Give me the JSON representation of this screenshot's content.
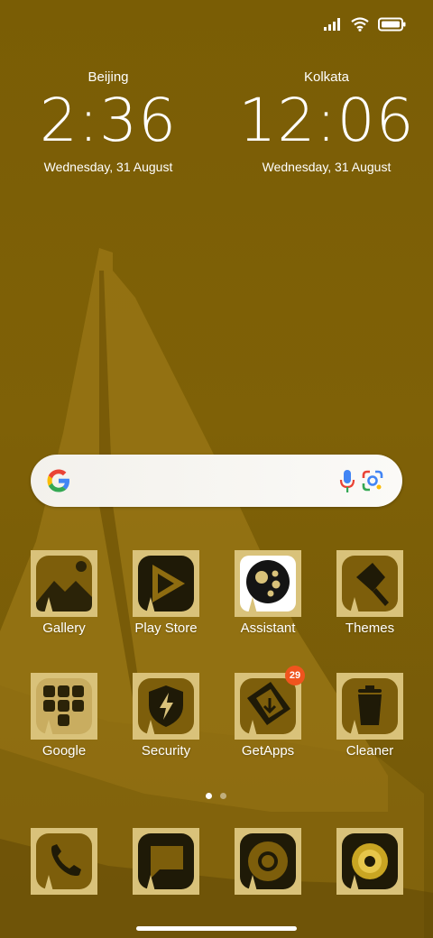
{
  "status": {
    "signal_icon": "signal-bars-icon",
    "wifi_icon": "wifi-icon",
    "battery_icon": "battery-icon",
    "battery_level": 0.95
  },
  "clocks": [
    {
      "city": "Beijing",
      "time": "2:36",
      "date": "Wednesday, 31 August"
    },
    {
      "city": "Kolkata",
      "time": "12:06",
      "date": "Wednesday, 31 August"
    }
  ],
  "search": {
    "logo_icon": "google-g-icon",
    "mic_icon": "microphone-icon",
    "lens_icon": "google-lens-icon"
  },
  "apps_row1": [
    {
      "label": "Gallery",
      "icon": "gallery-icon"
    },
    {
      "label": "Play Store",
      "icon": "play-store-icon"
    },
    {
      "label": "Assistant",
      "icon": "assistant-icon"
    },
    {
      "label": "Themes",
      "icon": "themes-brush-icon"
    }
  ],
  "apps_row2": [
    {
      "label": "Google",
      "icon": "google-folder-icon"
    },
    {
      "label": "Security",
      "icon": "security-shield-icon"
    },
    {
      "label": "GetApps",
      "icon": "getapps-icon",
      "badge": "29"
    },
    {
      "label": "Cleaner",
      "icon": "trash-icon"
    }
  ],
  "dock": [
    {
      "icon": "phone-icon"
    },
    {
      "icon": "messages-icon"
    },
    {
      "icon": "chrome-icon"
    },
    {
      "icon": "camera-icon"
    }
  ],
  "pager": {
    "pages": 2,
    "active": 1
  },
  "colors": {
    "wallpaper": "#7a5d05",
    "tile": "#d9c27a",
    "badge": "#f0541e"
  }
}
